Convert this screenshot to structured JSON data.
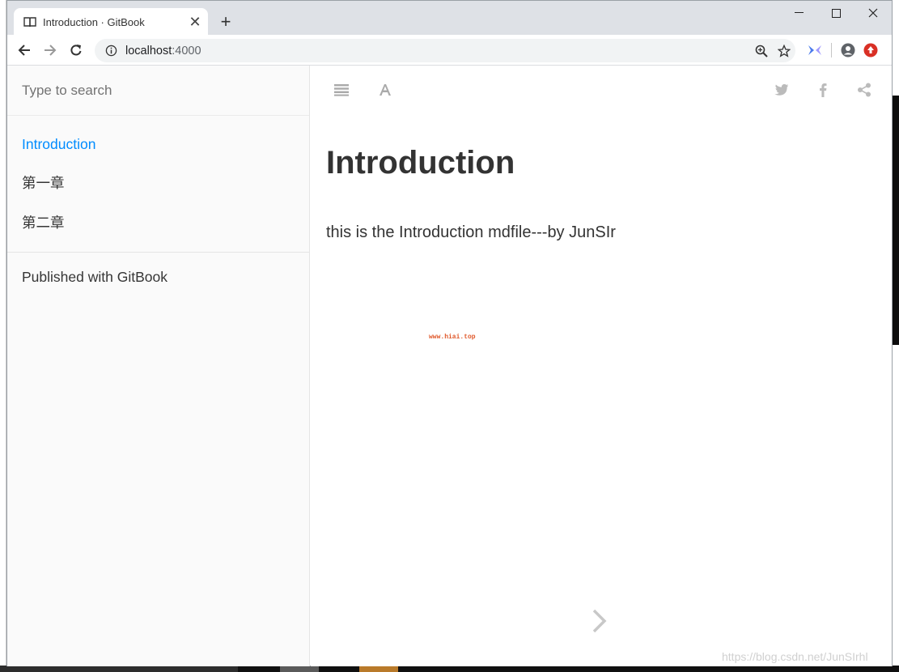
{
  "browser": {
    "tab_title": "Introduction · GitBook",
    "url_host": "localhost",
    "url_port": ":4000"
  },
  "sidebar": {
    "search_placeholder": "Type to search",
    "items": [
      {
        "label": "Introduction",
        "active": true
      },
      {
        "label": "第一章",
        "active": false
      },
      {
        "label": "第二章",
        "active": false
      }
    ],
    "published_label": "Published with GitBook"
  },
  "page": {
    "title": "Introduction",
    "body": "this is the Introduction mdfile---by JunSIr",
    "image_watermark": "www.hiai.top"
  },
  "watermark": "https://blog.csdn.net/JunSIrhl",
  "colors": {
    "accent": "#008cff",
    "text": "#333333",
    "sidebar_bg": "#fafafa",
    "chrome_bg": "#dee1e6",
    "icon_gray": "#aaaaaa"
  },
  "icons": {
    "header_left": [
      "list-icon",
      "font-icon"
    ],
    "header_right": [
      "twitter-icon",
      "facebook-icon",
      "share-icon"
    ]
  }
}
